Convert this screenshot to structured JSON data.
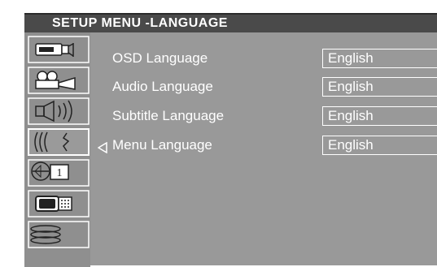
{
  "window": {
    "title": "SETUP MENU -LANGUAGE"
  },
  "sidebar": {
    "items": [
      {
        "icon": "camcorder-icon"
      },
      {
        "icon": "film-projector-icon"
      },
      {
        "icon": "speaker-icon"
      },
      {
        "icon": "language-audio-icon",
        "selected": true
      },
      {
        "icon": "clock-icon",
        "badge": "1"
      },
      {
        "icon": "tv-screen-icon"
      },
      {
        "icon": "disc-stack-icon"
      }
    ]
  },
  "settings": [
    {
      "label": "OSD Language",
      "value": "English"
    },
    {
      "label": "Audio Language",
      "value": "English"
    },
    {
      "label": "Subtitle Language",
      "value": "English"
    },
    {
      "label": "Menu Language",
      "value": "English",
      "active": true
    }
  ],
  "colors": {
    "panel": "#999999",
    "header": "#4a4a4a",
    "text": "#ffffff"
  }
}
